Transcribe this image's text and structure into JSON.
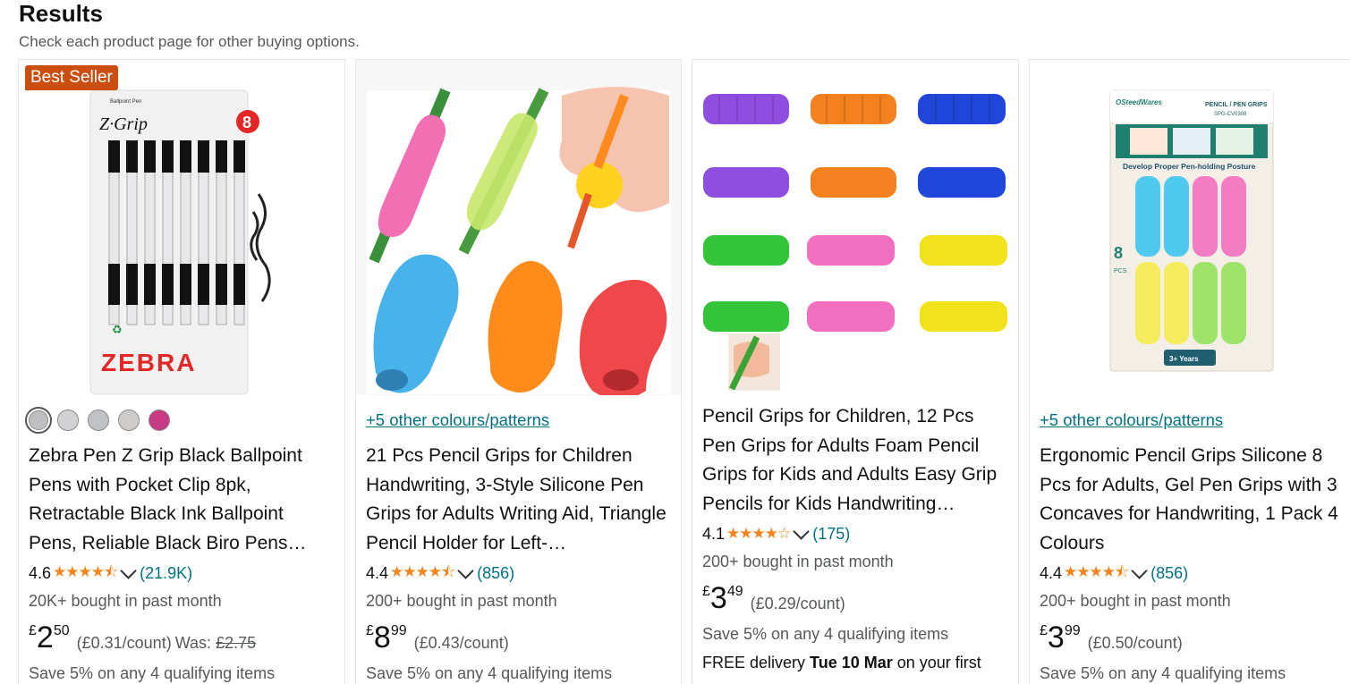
{
  "header": {
    "title": "Results",
    "subtitle": "Check each product page for other buying options."
  },
  "products": [
    {
      "badge": "Best Seller",
      "title": "Zebra Pen Z Grip Black Ballpoint Pens with Pocket Clip 8pk, Retractable Black Ink Ballpoint Pens, Reliable Black Biro Pens…",
      "rating": "4.6",
      "stars": "★★★★⯪",
      "review_count": "(21.9K)",
      "bought": "20K+ bought in past month",
      "currency": "£",
      "price_whole": "2",
      "price_fraction": "50",
      "unit_price": "(£0.31/count)",
      "was_label": "Was:",
      "was_price": "£2.75",
      "save": "Save 5% on any 4 qualifying items",
      "swatches": [
        "#bfbfc1",
        "#d2d2d4",
        "#c1c2c5",
        "#cfcdcb",
        "#c83a86"
      ]
    },
    {
      "other_colours": "+5 other colours/patterns",
      "title": "21 Pcs Pencil Grips for Children Handwriting, 3-Style Silicone Pen Grips for Adults Writing Aid, Triangle Pencil Holder for Left-…",
      "rating": "4.4",
      "stars": "★★★★⯪",
      "review_count": "(856)",
      "bought": "200+ bought in past month",
      "currency": "£",
      "price_whole": "8",
      "price_fraction": "99",
      "unit_price": "(£0.43/count)",
      "save": "Save 5% on any 4 qualifying items"
    },
    {
      "title": "Pencil Grips for Children, 12 Pcs Pen Grips for Adults Foam Pencil Grips for Kids and Adults Easy Grip Pencils for Kids Handwriting…",
      "rating": "4.1",
      "stars": "★★★★☆",
      "review_count": "(175)",
      "bought": "200+ bought in past month",
      "currency": "£",
      "price_whole": "3",
      "price_fraction": "49",
      "unit_price": "(£0.29/count)",
      "save": "Save 5% on any 4 qualifying items",
      "delivery_prefix": "FREE delivery ",
      "delivery_date": "Tue 10 Mar",
      "delivery_suffix": " on your first"
    },
    {
      "other_colours": "+5 other colours/patterns",
      "title": "Ergonomic Pencil Grips Silicone 8 Pcs for Adults, Gel Pen Grips with 3 Concaves for Handwriting, 1 Pack 4 Colours",
      "rating": "4.4",
      "stars": "★★★★⯪",
      "review_count": "(856)",
      "bought": "200+ bought in past month",
      "currency": "£",
      "price_whole": "3",
      "price_fraction": "99",
      "unit_price": "(£0.50/count)",
      "save": "Save 5% on any 4 qualifying items"
    }
  ],
  "image_text": {
    "p1_brand": "ZEBRA",
    "p1_logo": "Z·Grip",
    "p1_count": "8",
    "p1_tag": "Ballpoint Pen",
    "p4_brand": "OSteedWares",
    "p4_header": "PENCIL / PEN GRIPS",
    "p4_code": "SPG-CV0308",
    "p4_posture": "Develop Proper Pen-holding Posture",
    "p4_count": "8",
    "p4_pcs": "PCS",
    "p4_age": "3+ Years"
  }
}
